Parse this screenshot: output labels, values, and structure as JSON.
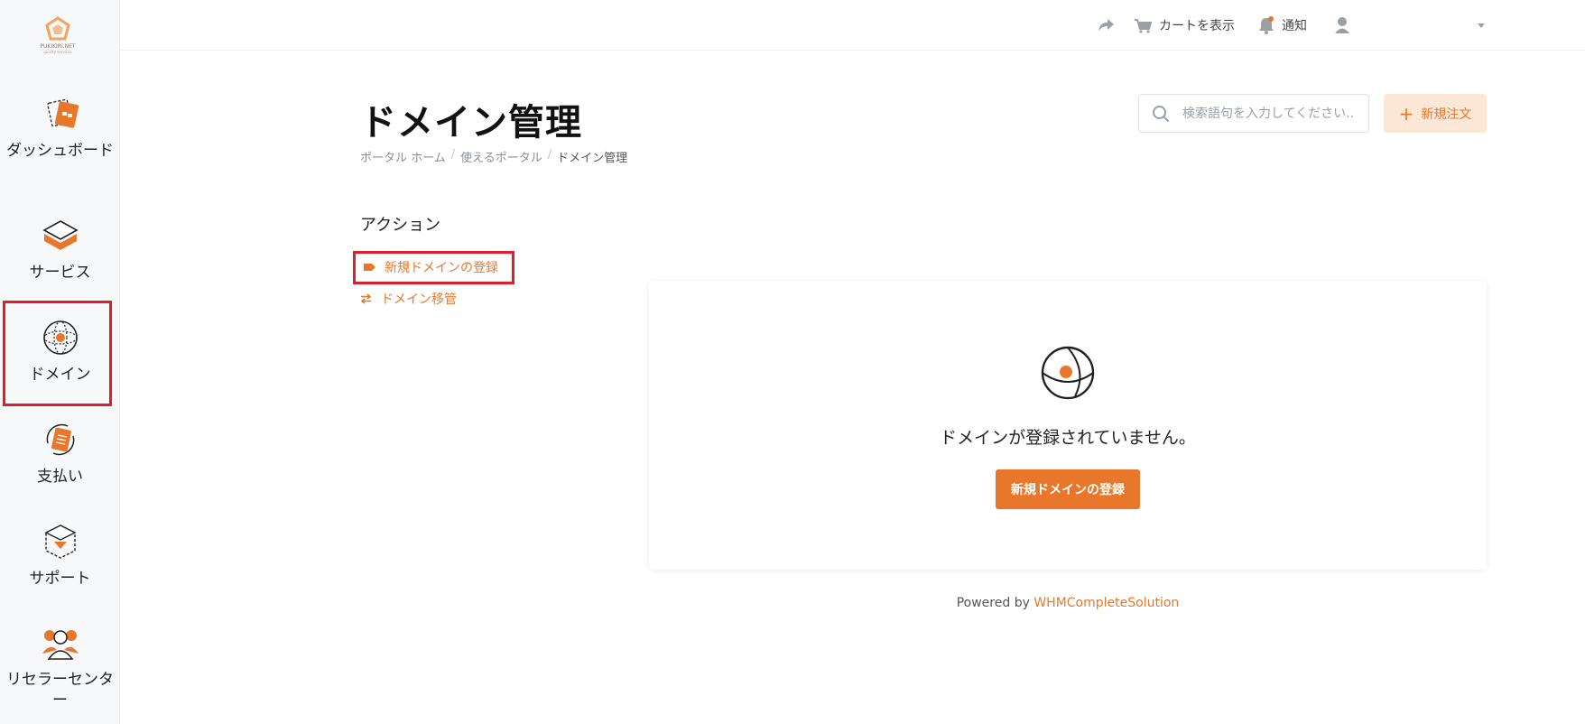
{
  "brand": {
    "logo_text": "PUKIKIRI.NET",
    "logo_sub": "quality services",
    "accent": "#e8772b",
    "highlight": "#e11d2a"
  },
  "sidebar": {
    "items": [
      {
        "label": "ダッシュボード",
        "icon": "dashboard-icon"
      },
      {
        "label": "サービス",
        "icon": "services-icon"
      },
      {
        "label": "ドメイン",
        "icon": "domain-globe-icon",
        "active": true
      },
      {
        "label": "支払い",
        "icon": "billing-icon"
      },
      {
        "label": "サポート",
        "icon": "support-icon"
      },
      {
        "label": "リセラーセンター",
        "icon": "reseller-icon"
      }
    ]
  },
  "topbar": {
    "share_icon": "share-icon",
    "cart_label": "カートを表示",
    "notify_label": "通知",
    "user_icon": "user-icon"
  },
  "page": {
    "title": "ドメイン管理",
    "breadcrumb": [
      "ポータル ホーム",
      "使えるポータル",
      "ドメイン管理"
    ],
    "search_placeholder": "検索語句を入力してください...",
    "new_order_label": "新規注文"
  },
  "actions": {
    "heading": "アクション",
    "items": [
      {
        "label": "新規ドメインの登録",
        "icon": "tag-icon"
      },
      {
        "label": "ドメイン移管",
        "icon": "transfer-icon"
      }
    ]
  },
  "empty_state": {
    "message": "ドメインが登録されていません。",
    "button_label": "新規ドメインの登録"
  },
  "footer": {
    "prefix": "Powered by",
    "link": "WHMCompleteSolution"
  }
}
